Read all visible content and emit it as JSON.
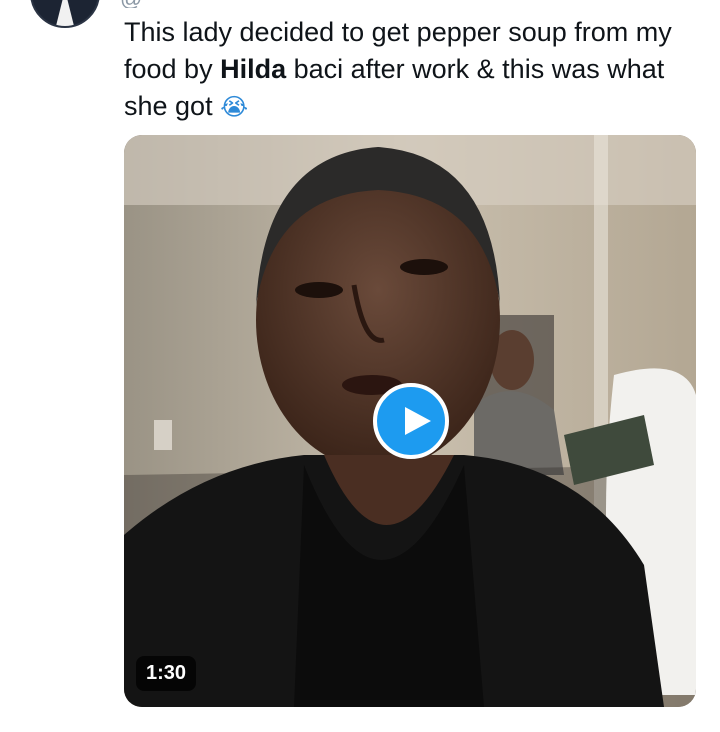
{
  "tweet": {
    "text_part1": "This lady decided to get pepper soup from my food by ",
    "text_bold": "Hilda",
    "text_part2": " baci after work & this was what she got ",
    "emoji": "😭"
  },
  "video": {
    "duration": "1:30",
    "play_icon": "play-icon"
  },
  "colors": {
    "accent": "#1d9bf0",
    "text": "#0f1419"
  }
}
